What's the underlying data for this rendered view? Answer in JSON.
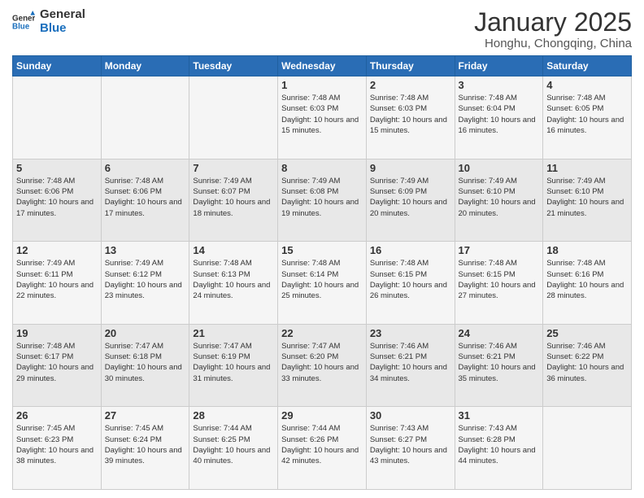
{
  "logo": {
    "line1": "General",
    "line2": "Blue"
  },
  "title": "January 2025",
  "location": "Honghu, Chongqing, China",
  "days_of_week": [
    "Sunday",
    "Monday",
    "Tuesday",
    "Wednesday",
    "Thursday",
    "Friday",
    "Saturday"
  ],
  "weeks": [
    [
      {
        "day": "",
        "info": ""
      },
      {
        "day": "",
        "info": ""
      },
      {
        "day": "",
        "info": ""
      },
      {
        "day": "1",
        "info": "Sunrise: 7:48 AM\nSunset: 6:03 PM\nDaylight: 10 hours and 15 minutes."
      },
      {
        "day": "2",
        "info": "Sunrise: 7:48 AM\nSunset: 6:03 PM\nDaylight: 10 hours and 15 minutes."
      },
      {
        "day": "3",
        "info": "Sunrise: 7:48 AM\nSunset: 6:04 PM\nDaylight: 10 hours and 16 minutes."
      },
      {
        "day": "4",
        "info": "Sunrise: 7:48 AM\nSunset: 6:05 PM\nDaylight: 10 hours and 16 minutes."
      }
    ],
    [
      {
        "day": "5",
        "info": "Sunrise: 7:48 AM\nSunset: 6:06 PM\nDaylight: 10 hours and 17 minutes."
      },
      {
        "day": "6",
        "info": "Sunrise: 7:48 AM\nSunset: 6:06 PM\nDaylight: 10 hours and 17 minutes."
      },
      {
        "day": "7",
        "info": "Sunrise: 7:49 AM\nSunset: 6:07 PM\nDaylight: 10 hours and 18 minutes."
      },
      {
        "day": "8",
        "info": "Sunrise: 7:49 AM\nSunset: 6:08 PM\nDaylight: 10 hours and 19 minutes."
      },
      {
        "day": "9",
        "info": "Sunrise: 7:49 AM\nSunset: 6:09 PM\nDaylight: 10 hours and 20 minutes."
      },
      {
        "day": "10",
        "info": "Sunrise: 7:49 AM\nSunset: 6:10 PM\nDaylight: 10 hours and 20 minutes."
      },
      {
        "day": "11",
        "info": "Sunrise: 7:49 AM\nSunset: 6:10 PM\nDaylight: 10 hours and 21 minutes."
      }
    ],
    [
      {
        "day": "12",
        "info": "Sunrise: 7:49 AM\nSunset: 6:11 PM\nDaylight: 10 hours and 22 minutes."
      },
      {
        "day": "13",
        "info": "Sunrise: 7:49 AM\nSunset: 6:12 PM\nDaylight: 10 hours and 23 minutes."
      },
      {
        "day": "14",
        "info": "Sunrise: 7:48 AM\nSunset: 6:13 PM\nDaylight: 10 hours and 24 minutes."
      },
      {
        "day": "15",
        "info": "Sunrise: 7:48 AM\nSunset: 6:14 PM\nDaylight: 10 hours and 25 minutes."
      },
      {
        "day": "16",
        "info": "Sunrise: 7:48 AM\nSunset: 6:15 PM\nDaylight: 10 hours and 26 minutes."
      },
      {
        "day": "17",
        "info": "Sunrise: 7:48 AM\nSunset: 6:15 PM\nDaylight: 10 hours and 27 minutes."
      },
      {
        "day": "18",
        "info": "Sunrise: 7:48 AM\nSunset: 6:16 PM\nDaylight: 10 hours and 28 minutes."
      }
    ],
    [
      {
        "day": "19",
        "info": "Sunrise: 7:48 AM\nSunset: 6:17 PM\nDaylight: 10 hours and 29 minutes."
      },
      {
        "day": "20",
        "info": "Sunrise: 7:47 AM\nSunset: 6:18 PM\nDaylight: 10 hours and 30 minutes."
      },
      {
        "day": "21",
        "info": "Sunrise: 7:47 AM\nSunset: 6:19 PM\nDaylight: 10 hours and 31 minutes."
      },
      {
        "day": "22",
        "info": "Sunrise: 7:47 AM\nSunset: 6:20 PM\nDaylight: 10 hours and 33 minutes."
      },
      {
        "day": "23",
        "info": "Sunrise: 7:46 AM\nSunset: 6:21 PM\nDaylight: 10 hours and 34 minutes."
      },
      {
        "day": "24",
        "info": "Sunrise: 7:46 AM\nSunset: 6:21 PM\nDaylight: 10 hours and 35 minutes."
      },
      {
        "day": "25",
        "info": "Sunrise: 7:46 AM\nSunset: 6:22 PM\nDaylight: 10 hours and 36 minutes."
      }
    ],
    [
      {
        "day": "26",
        "info": "Sunrise: 7:45 AM\nSunset: 6:23 PM\nDaylight: 10 hours and 38 minutes."
      },
      {
        "day": "27",
        "info": "Sunrise: 7:45 AM\nSunset: 6:24 PM\nDaylight: 10 hours and 39 minutes."
      },
      {
        "day": "28",
        "info": "Sunrise: 7:44 AM\nSunset: 6:25 PM\nDaylight: 10 hours and 40 minutes."
      },
      {
        "day": "29",
        "info": "Sunrise: 7:44 AM\nSunset: 6:26 PM\nDaylight: 10 hours and 42 minutes."
      },
      {
        "day": "30",
        "info": "Sunrise: 7:43 AM\nSunset: 6:27 PM\nDaylight: 10 hours and 43 minutes."
      },
      {
        "day": "31",
        "info": "Sunrise: 7:43 AM\nSunset: 6:28 PM\nDaylight: 10 hours and 44 minutes."
      },
      {
        "day": "",
        "info": ""
      }
    ]
  ]
}
